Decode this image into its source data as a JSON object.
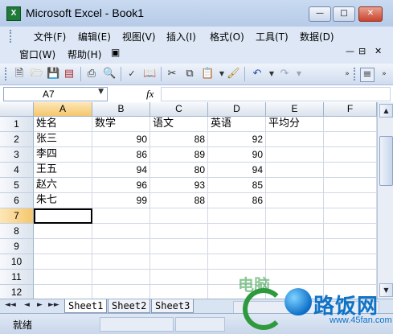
{
  "window": {
    "title": "Microsoft Excel - Book1",
    "app_icon_letter": "X",
    "controls": {
      "minimize": "—",
      "maximize": "□",
      "close": "✕"
    }
  },
  "menubar": {
    "row1": [
      "文件(F)",
      "编辑(E)",
      "视图(V)",
      "插入(I)",
      "格式(O)",
      "工具(T)",
      "数据(D)"
    ],
    "row2": [
      "窗口(W)",
      "帮助(H)"
    ],
    "doc_controls": {
      "minimize": "—",
      "restore": "🗗",
      "close": "✕"
    }
  },
  "toolbar": {
    "icons": [
      "new-icon",
      "open-icon",
      "save-icon",
      "permission-icon",
      "print-icon",
      "print-preview-icon",
      "spelling-icon",
      "research-icon",
      "cut-icon",
      "copy-icon",
      "paste-icon",
      "format-painter-icon",
      "undo-icon",
      "redo-icon",
      "align-icon"
    ]
  },
  "formula_bar": {
    "name_box": "A7",
    "fx_label": "fx",
    "formula": ""
  },
  "sheet": {
    "columns": [
      "A",
      "B",
      "C",
      "D",
      "E",
      "F"
    ],
    "active_column": "A",
    "active_row": 7,
    "rows": [
      {
        "num": "1",
        "cells": [
          "姓名",
          "数学",
          "语文",
          "英语",
          "平均分",
          ""
        ]
      },
      {
        "num": "2",
        "cells": [
          "张三",
          "90",
          "88",
          "92",
          "",
          ""
        ]
      },
      {
        "num": "3",
        "cells": [
          "李四",
          "86",
          "89",
          "90",
          "",
          ""
        ]
      },
      {
        "num": "4",
        "cells": [
          "王五",
          "94",
          "80",
          "94",
          "",
          ""
        ]
      },
      {
        "num": "5",
        "cells": [
          "赵六",
          "96",
          "93",
          "85",
          "",
          ""
        ]
      },
      {
        "num": "6",
        "cells": [
          "朱七",
          "99",
          "88",
          "86",
          "",
          ""
        ]
      },
      {
        "num": "7",
        "cells": [
          "",
          "",
          "",
          "",
          "",
          ""
        ]
      },
      {
        "num": "8",
        "cells": [
          "",
          "",
          "",
          "",
          "",
          ""
        ]
      },
      {
        "num": "9",
        "cells": [
          "",
          "",
          "",
          "",
          "",
          ""
        ]
      },
      {
        "num": "10",
        "cells": [
          "",
          "",
          "",
          "",
          "",
          ""
        ]
      },
      {
        "num": "11",
        "cells": [
          "",
          "",
          "",
          "",
          "",
          ""
        ]
      },
      {
        "num": "12",
        "cells": [
          "",
          "",
          "",
          "",
          "",
          ""
        ]
      }
    ]
  },
  "tabs": {
    "nav": [
      "◄◄",
      "◄",
      "►",
      "►►"
    ],
    "sheets": [
      "Sheet1",
      "Sheet2",
      "Sheet3"
    ],
    "active": "Sheet1"
  },
  "statusbar": {
    "text": "就绪"
  },
  "watermark": {
    "brand": "路饭网",
    "url": "www.45fan.com",
    "cn_prefix": "电脑"
  }
}
